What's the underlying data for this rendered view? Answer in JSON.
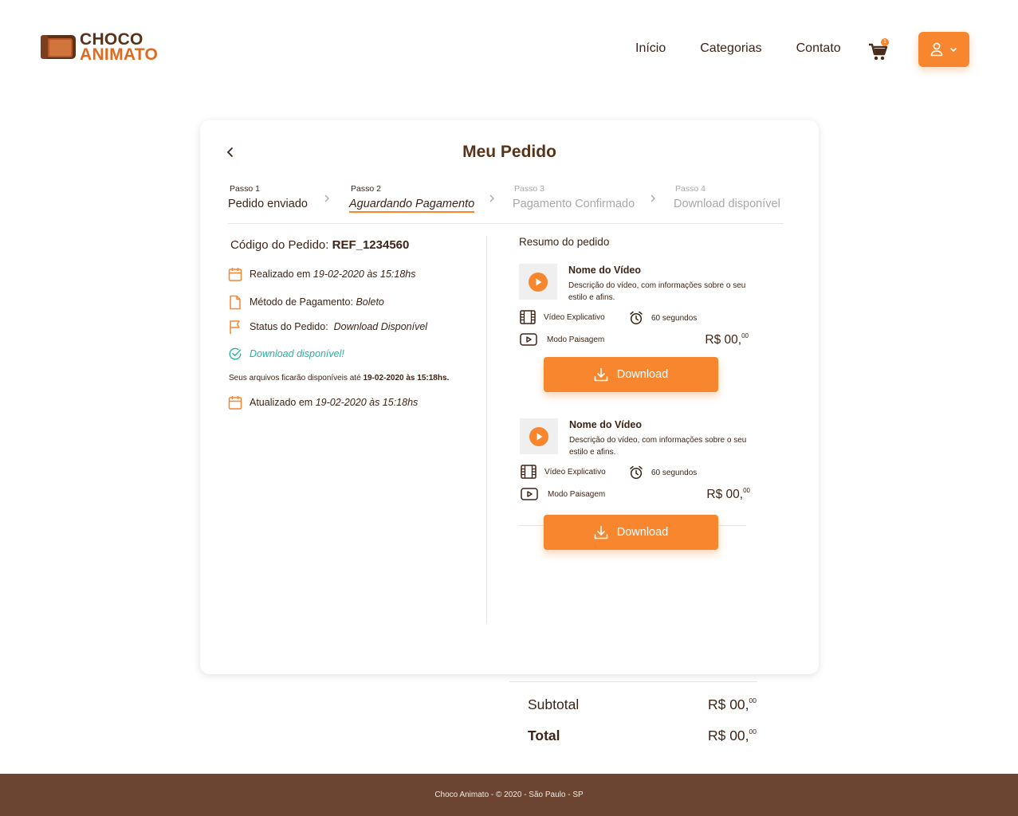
{
  "brand": {
    "line1": "CHOCO",
    "line2": "ANIMATO"
  },
  "nav": {
    "items": [
      "Início",
      "Categorias",
      "Contato"
    ],
    "cart_count": "1"
  },
  "order": {
    "title": "Meu Pedido",
    "steps": [
      {
        "num": "Passo 1",
        "label": "Pedido enviado",
        "state": "done"
      },
      {
        "num": "Passo 2",
        "label": "Aguardando Pagamento",
        "state": "active"
      },
      {
        "num": "Passo 3",
        "label": "Pagamento Confirmado",
        "state": "pending"
      },
      {
        "num": "Passo 4",
        "label": "Download disponível",
        "state": "pending"
      }
    ],
    "code_label": "Código do Pedido:",
    "code_value": "REF_1234560",
    "created_label": "Realizado em",
    "created_value": "19-02-2020 às 15:18hs",
    "payment_label": "Método de Pagamento:",
    "payment_value": "Boleto",
    "status_label": "Status do Pedido:",
    "status_value": "Download Disponível",
    "download_available": "Download disponível!",
    "note_prefix": "Seus arquivos ficarão disponíveis até",
    "note_value": "19-02-2020 às 15:18hs.",
    "updated_label": "Atualizado em",
    "updated_value": "19-02-2020 às 15:18hs"
  },
  "summary": {
    "title": "Resumo do pedido",
    "items": [
      {
        "name": "Nome do Vídeo",
        "description": "Descrição do vídeo, com informações sobre o seu estilo e afins.",
        "type": "Vídeo Explicativo",
        "duration": "60 segundos",
        "orientation": "Modo Paisagem",
        "price_main": "R$ 00,",
        "price_cents": "00",
        "button": "Download"
      },
      {
        "name": "Nome do Vídeo",
        "description": "Descrição do vídeo, com informações sobre o seu estilo e afins.",
        "type": "Vídeo Explicativo",
        "duration": "60 segundos",
        "orientation": "Modo Paisagem",
        "price_main": "R$ 00,",
        "price_cents": "00",
        "button": "Download"
      }
    ],
    "subtotal_label": "Subtotal",
    "subtotal_main": "R$ 00,",
    "subtotal_cents": "00",
    "total_label": "Total",
    "total_main": "R$ 00,",
    "total_cents": "00"
  },
  "footer": {
    "text": "Choco Animato - © 2020 - São Paulo - SP"
  },
  "colors": {
    "accent": "#f7862f",
    "brown": "#5a3218",
    "footer": "#6b4531",
    "success": "#2ab0a0"
  }
}
